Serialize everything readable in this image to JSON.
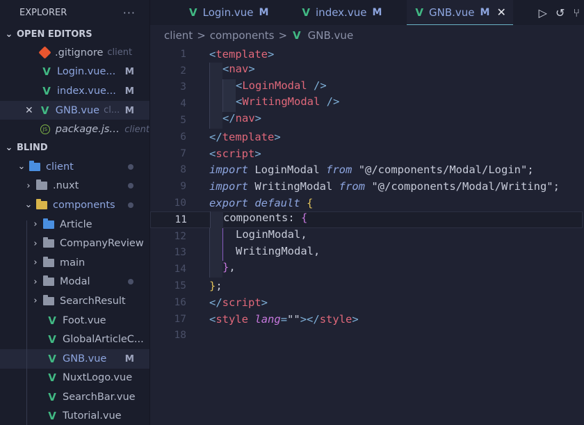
{
  "explorer": {
    "title": "EXPLORER",
    "more": "···",
    "open_editors_title": "OPEN EDITORS",
    "open_editors": [
      {
        "name": ".gitignore",
        "meta": "client",
        "badge": ""
      },
      {
        "name": "Login.vue...",
        "meta": "",
        "badge": "M"
      },
      {
        "name": "index.vue...",
        "meta": "",
        "badge": "M"
      },
      {
        "name": "GNB.vue",
        "meta": "cl...",
        "badge": "M"
      },
      {
        "name": "package.json",
        "meta": "client",
        "badge": ""
      }
    ],
    "project_title": "BLIND",
    "tree": [
      {
        "name": "client"
      },
      {
        "name": ".nuxt"
      },
      {
        "name": "components"
      },
      {
        "name": "Article"
      },
      {
        "name": "CompanyReview"
      },
      {
        "name": "main"
      },
      {
        "name": "Modal"
      },
      {
        "name": "SearchResult"
      },
      {
        "name": "Foot.vue"
      },
      {
        "name": "GlobalArticleC..."
      },
      {
        "name": "GNB.vue",
        "badge": "M"
      },
      {
        "name": "NuxtLogo.vue"
      },
      {
        "name": "SearchBar.vue"
      },
      {
        "name": "Tutorial.vue"
      }
    ]
  },
  "tabs": [
    {
      "label": "Login.vue",
      "badge": "M"
    },
    {
      "label": "index.vue",
      "badge": "M"
    },
    {
      "label": "GNB.vue",
      "badge": "M",
      "close": "✕"
    }
  ],
  "breadcrumb": {
    "parts": [
      "client",
      "components",
      "GNB.vue"
    ],
    "sep": ">"
  },
  "editor": {
    "line_numbers": [
      "1",
      "2",
      "3",
      "4",
      "5",
      "6",
      "7",
      "8",
      "9",
      "10",
      "11",
      "12",
      "13",
      "14",
      "15",
      "16",
      "17",
      "18"
    ],
    "current_line": "11",
    "code": {
      "l1_tag": "template",
      "l2_tag": "nav",
      "l3_comp": "LoginModal",
      "l4_comp": "WritingModal",
      "l5_tag": "nav",
      "l6_tag": "template",
      "l7_tag": "script",
      "kw_import": "import",
      "kw_from": "from",
      "l8_name": "LoginModal",
      "l8_path": "\"@/components/Modal/Login\"",
      "l9_name": "WritingModal",
      "l9_path": "\"@/components/Modal/Writing\"",
      "kw_export": "export",
      "kw_default": "default",
      "l11_key": "components",
      "l12_item": "LoginModal,",
      "l13_item": "WritingModal,",
      "l16_tag": "script",
      "l17_tag": "style",
      "l17_attr": "lang",
      "l17_val": "\"\""
    }
  }
}
